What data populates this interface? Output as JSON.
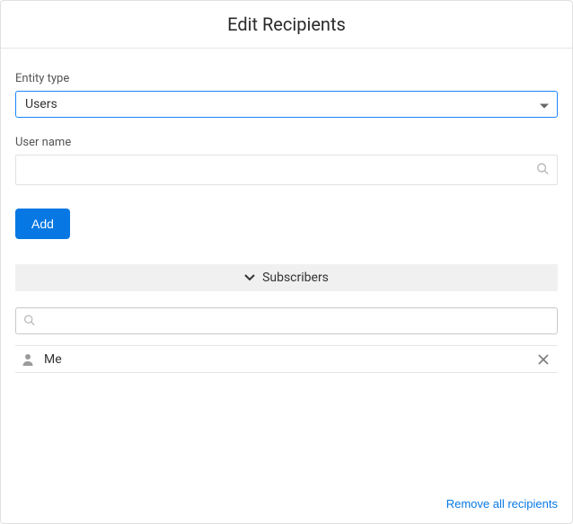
{
  "header": {
    "title": "Edit Recipients"
  },
  "entityType": {
    "label": "Entity type",
    "value": "Users"
  },
  "userName": {
    "label": "User name",
    "value": ""
  },
  "addButton": {
    "label": "Add"
  },
  "subscribersSection": {
    "title": "Subscribers",
    "filterValue": ""
  },
  "subscribers": [
    {
      "label": "Me"
    }
  ],
  "footer": {
    "removeAll": "Remove all recipients"
  }
}
